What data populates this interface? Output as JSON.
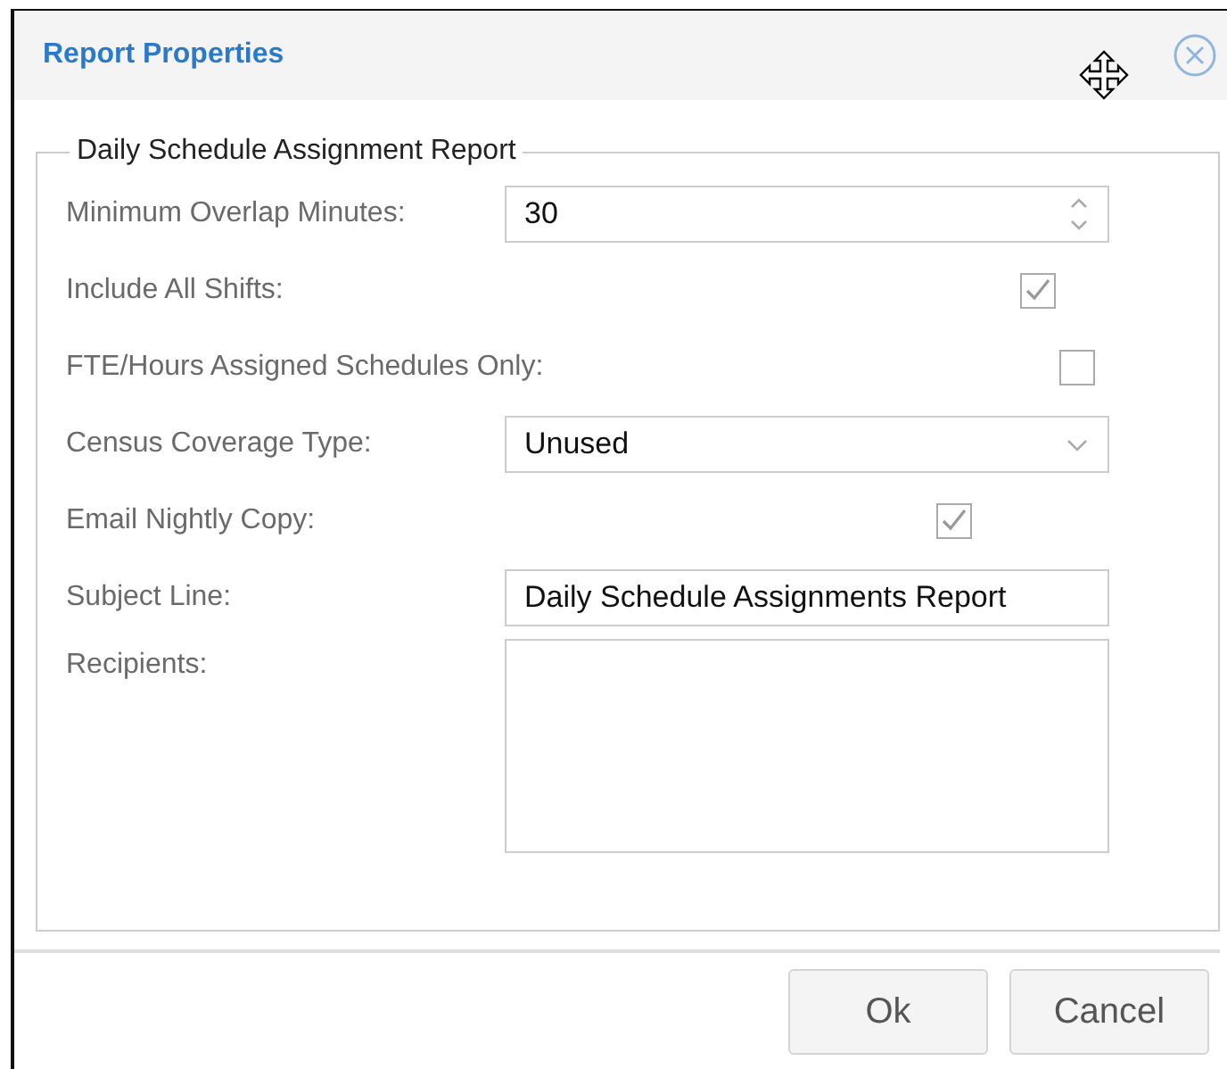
{
  "window": {
    "title": "Report Properties"
  },
  "group": {
    "legend": "Daily Schedule Assignment Report",
    "fields": [
      {
        "kind": "number",
        "label": "Minimum Overlap Minutes:",
        "value": "30"
      },
      {
        "kind": "checkbox",
        "label": "Include All Shifts:",
        "checked": true
      },
      {
        "kind": "checkbox",
        "label": "FTE/Hours Assigned Schedules Only:",
        "checked": false
      },
      {
        "kind": "select",
        "label": "Census Coverage Type:",
        "value": "Unused"
      },
      {
        "kind": "checkbox",
        "label": "Email Nightly Copy:",
        "checked": true
      },
      {
        "kind": "text",
        "label": "Subject Line:",
        "value": "Daily Schedule Assignments Report"
      },
      {
        "kind": "textarea",
        "label": "Recipients:"
      }
    ]
  },
  "buttons": [
    "Ok",
    "Cancel"
  ]
}
